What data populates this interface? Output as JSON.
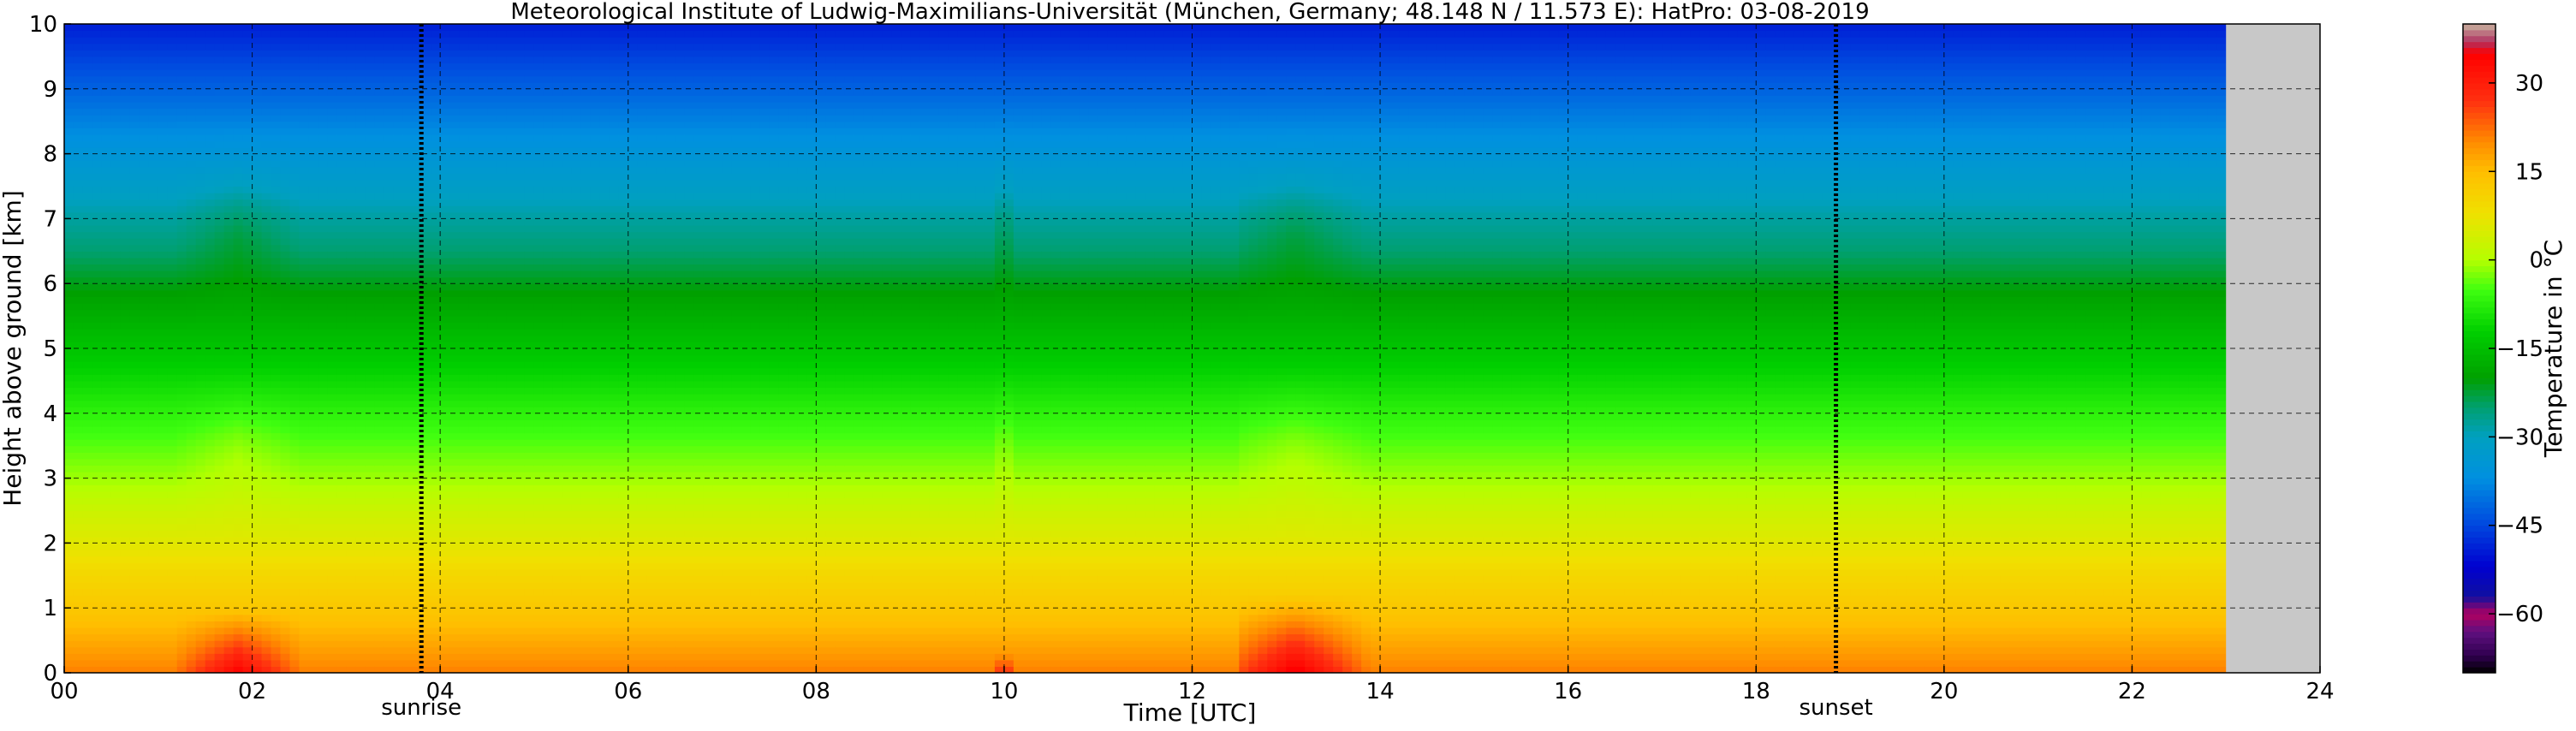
{
  "chart_data": {
    "type": "heatmap",
    "title": "Meteorological Institute of Ludwig-Maximilians-Universität (München, Germany; 48.148 N / 11.573 E):    HatPro: 03-08-2019",
    "xlabel": "Time [UTC]",
    "ylabel": "Height above ground [km]",
    "xlim": [
      0,
      24
    ],
    "ylim": [
      0,
      10
    ],
    "x_ticks": [
      "00",
      "02",
      "04",
      "06",
      "08",
      "10",
      "12",
      "14",
      "16",
      "18",
      "20",
      "22",
      "24"
    ],
    "y_ticks": [
      "0",
      "1",
      "2",
      "3",
      "4",
      "5",
      "6",
      "7",
      "8",
      "9",
      "10"
    ],
    "grid": true,
    "data_end_time": 23.0,
    "no_data_color": "#c8c8c8",
    "annotations": [
      {
        "label": "sunrise",
        "time": 3.8
      },
      {
        "label": "sunset",
        "time": 18.85
      }
    ],
    "marker_line_times": [
      3.8,
      18.85
    ],
    "temperature_profile": {
      "heights_km": [
        0,
        0.5,
        1,
        1.5,
        2,
        2.5,
        3,
        3.5,
        4,
        5,
        6,
        6.5,
        7,
        8,
        9,
        10
      ],
      "temperatures_c": [
        21,
        17,
        13,
        10,
        6,
        3,
        -1,
        -4,
        -7,
        -14,
        -21,
        -25,
        -28,
        -35,
        -42,
        -49
      ]
    },
    "warm_events": [
      {
        "time_start": 1.25,
        "time_end": 2.5,
        "peak_time": 1.85,
        "max_height_km": 1.0,
        "surface_max_c": 35
      },
      {
        "time_start": 12.45,
        "time_end": 13.9,
        "peak_time": 13.1,
        "max_height_km": 1.2,
        "surface_max_c": 37
      },
      {
        "time_start": 9.9,
        "time_end": 10.1,
        "peak_time": 10.0,
        "max_height_km": 0.3,
        "surface_max_c": 32
      }
    ],
    "colorbar": {
      "label": "Temperature in °C",
      "min": -70,
      "max": 40,
      "ticks": [
        "30",
        "15",
        "0",
        "−15",
        "−30",
        "−45",
        "−60"
      ],
      "tick_values": [
        30,
        15,
        0,
        -15,
        -30,
        -45,
        -60
      ],
      "colors": [
        {
          "value": 40,
          "color": "#c8b4a0"
        },
        {
          "value": 37,
          "color": "#b03060"
        },
        {
          "value": 35,
          "color": "#ff0000"
        },
        {
          "value": 27,
          "color": "#ff3010"
        },
        {
          "value": 20,
          "color": "#ff8c00"
        },
        {
          "value": 15,
          "color": "#ffbe00"
        },
        {
          "value": 8,
          "color": "#f0e000"
        },
        {
          "value": 0,
          "color": "#b4ff00"
        },
        {
          "value": -5,
          "color": "#40ff10"
        },
        {
          "value": -12,
          "color": "#00d000"
        },
        {
          "value": -20,
          "color": "#00a000"
        },
        {
          "value": -25,
          "color": "#00a070"
        },
        {
          "value": -30,
          "color": "#00a0c0"
        },
        {
          "value": -37,
          "color": "#0090e0"
        },
        {
          "value": -44,
          "color": "#0050e0"
        },
        {
          "value": -52,
          "color": "#0000d0"
        },
        {
          "value": -57,
          "color": "#1010a0"
        },
        {
          "value": -60,
          "color": "#b00060"
        },
        {
          "value": -63,
          "color": "#601080"
        },
        {
          "value": -67,
          "color": "#300050"
        },
        {
          "value": -70,
          "color": "#000000"
        }
      ]
    }
  }
}
